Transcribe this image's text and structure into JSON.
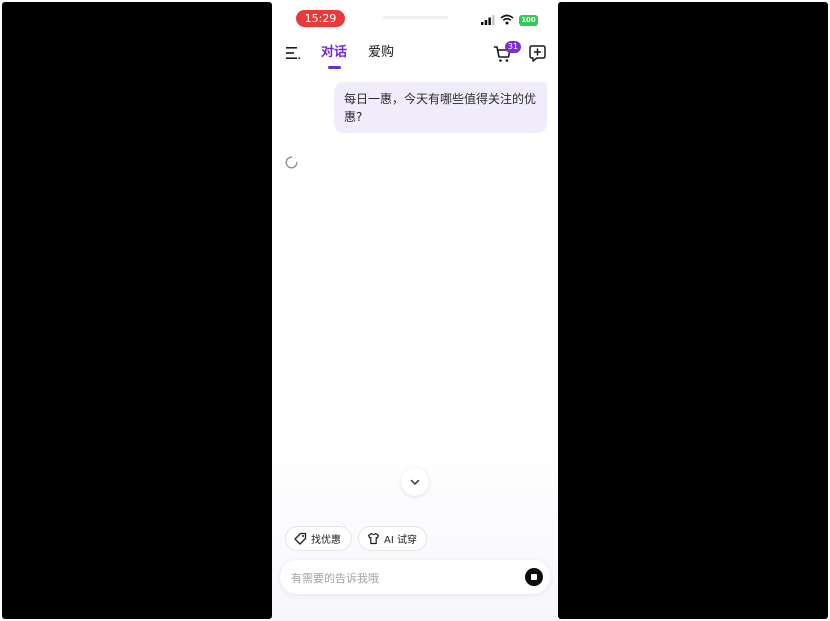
{
  "status_bar": {
    "time": "15:29",
    "battery": "100"
  },
  "header": {
    "tabs": [
      {
        "label": "对话",
        "active": true
      },
      {
        "label": "爱购",
        "active": false
      }
    ],
    "cart_badge": "31"
  },
  "chat": {
    "user_message": "每日一惠，今天有哪些值得关注的优惠?"
  },
  "quick_actions": [
    {
      "label": "找优惠",
      "icon": "tag-icon"
    },
    {
      "label": "AI 试穿",
      "icon": "shirt-icon"
    }
  ],
  "composer": {
    "placeholder": "有需要的告诉我哦"
  },
  "colors": {
    "accent": "#6e2bd0",
    "time_pill": "#e83a3a",
    "battery": "#34c759",
    "bubble": "#f1ecfb"
  }
}
